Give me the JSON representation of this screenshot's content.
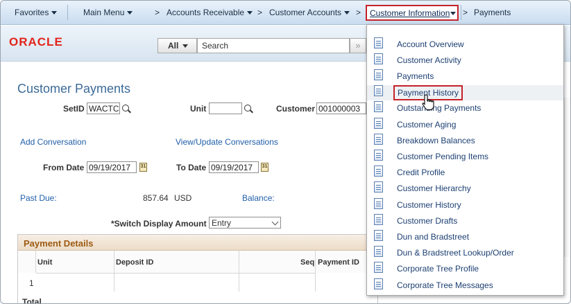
{
  "nav": {
    "favorites": "Favorites",
    "main_menu": "Main Menu",
    "sep": ">",
    "accounts_receivable": "Accounts Receivable",
    "customer_accounts": "Customer Accounts",
    "customer_information": "Customer Information",
    "payments": "Payments"
  },
  "header": {
    "logo": "ORACLE",
    "search_scope": "All",
    "search_placeholder": "Search",
    "search_go": "»"
  },
  "page": {
    "title": "Customer Payments",
    "setid_label": "SetID",
    "setid_value": "WACTC",
    "unit_label": "Unit",
    "unit_value": "",
    "customer_label": "Customer",
    "customer_value": "001000003",
    "add_conversation": "Add Conversation",
    "view_update_conversations": "View/Update Conversations",
    "from_date_label": "From Date",
    "from_date_value": "09/19/2017",
    "to_date_label": "To Date",
    "to_date_value": "09/19/2017",
    "calendar_glyph": "31",
    "past_due_label": "Past Due:",
    "past_due_amount": "857.64",
    "currency": "USD",
    "balance_label": "Balance:",
    "switch_display_label": "*Switch Display Amount",
    "switch_display_value": "Entry"
  },
  "payment_details": {
    "title": "Payment Details",
    "columns": [
      "Unit",
      "Deposit ID",
      "Seq",
      "Payment ID"
    ],
    "row_number": "1",
    "totals_label": "Total"
  },
  "menu": {
    "items": [
      "Account Overview",
      "Customer Activity",
      "Payments",
      "Payment History",
      "Outstanding Payments",
      "Customer Aging",
      "Breakdown Balances",
      "Customer Pending Items",
      "Credit Profile",
      "Customer Hierarchy",
      "Customer History",
      "Customer Drafts",
      "Dun and Bradstreet",
      "Dun & Bradstreet Lookup/Order",
      "Corporate Tree Profile",
      "Corporate Tree Messages"
    ],
    "highlighted_index": 3
  },
  "colors": {
    "highlight_border": "#c4222a",
    "link": "#1f5ea8",
    "menu_text": "#1c3f72"
  }
}
